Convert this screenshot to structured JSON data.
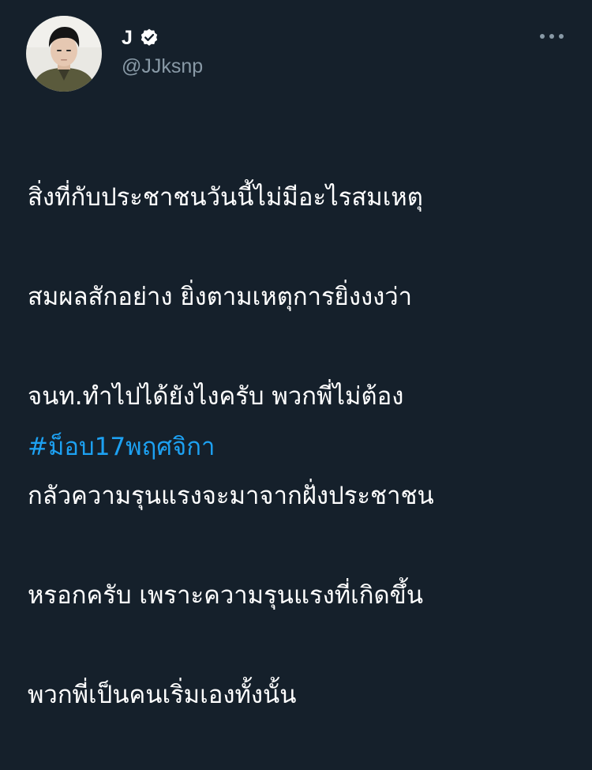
{
  "tweet": {
    "author": {
      "display_name": "J",
      "handle": "@JJksnp",
      "verified": true,
      "avatar_icon": "profile-photo"
    },
    "more_icon": "more-options-icon",
    "body_lines": [
      "สิ่งที่กับประชาชนวันนี้ไม่มีอะไรสมเหตุ",
      "สมผลสักอย่าง ยิ่งตามเหตุการยิ่งงงว่า",
      "จนท.ทำไปได้ยังไงครับ พวกพี่ไม่ต้อง",
      "กลัวความรุนแรงจะมาจากฝั่งประชาชน",
      "หรอกครับ เพราะความรุนแรงที่เกิดขึ้น",
      "พวกพี่เป็นคนเริ่มเองทั้งนั้น"
    ],
    "hashtag": "#ม็อบ17พฤศจิกา"
  },
  "colors": {
    "background": "#15202b",
    "text": "#ffffff",
    "secondary_text": "#8899a6",
    "link": "#1da1f2"
  }
}
